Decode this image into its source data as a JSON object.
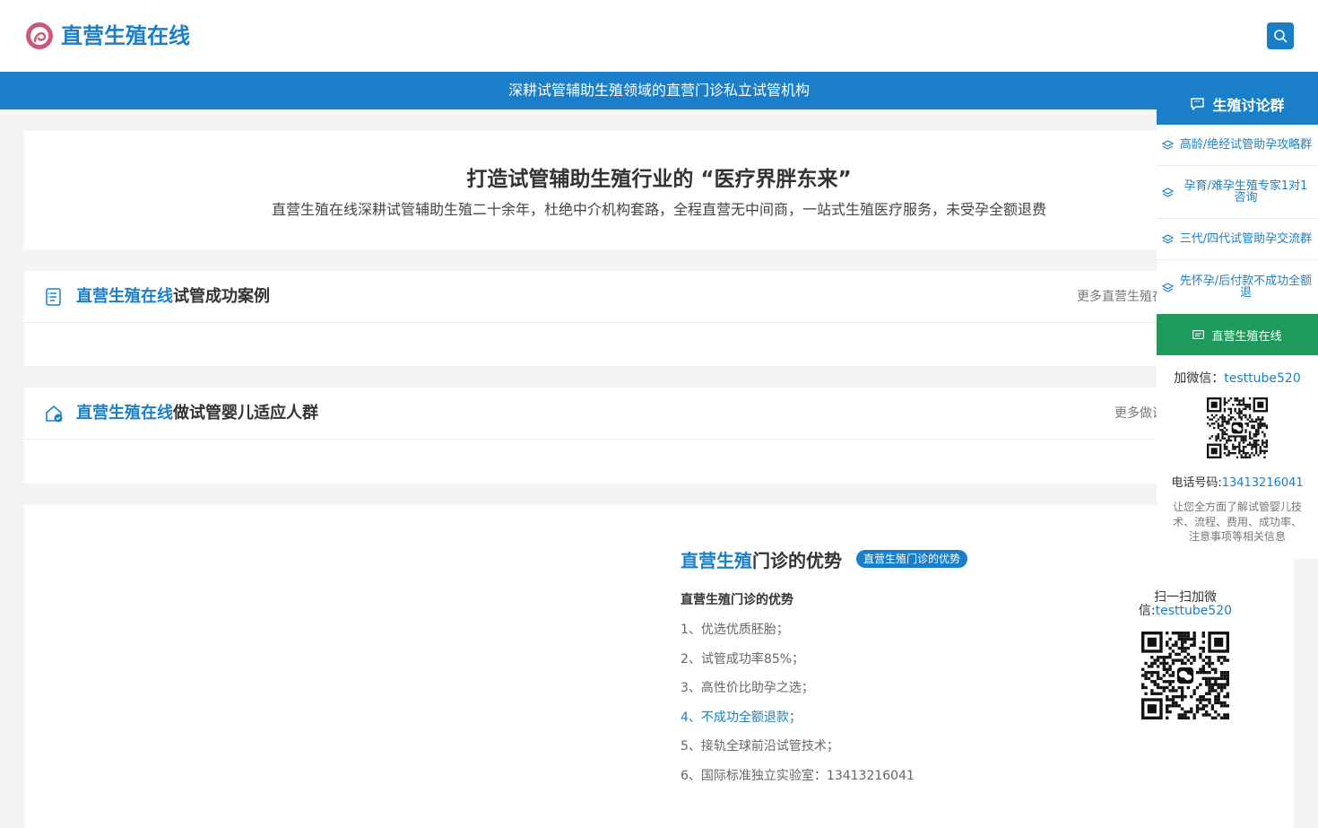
{
  "header": {
    "brand": "直营生殖在线",
    "logo_icon": "logo-icon",
    "search_icon": "search-icon"
  },
  "banner": {
    "text": "深耕试管辅助生殖领域的直营门诊私立试管机构"
  },
  "hero": {
    "title": "打造试管辅助生殖行业的 “医疗界胖东来”",
    "subtitle": "直营生殖在线深耕试管辅助生殖二十余年，杜绝中介机构套路，全程直营无中间商，一站式生殖医疗服务，未受孕全额退费"
  },
  "sections": [
    {
      "title_highlight": "直营生殖在线",
      "title_rest": "试管成功案例",
      "more": "更多直营生殖在",
      "icon": "document-list-icon"
    },
    {
      "title_highlight": "直营生殖在线",
      "title_rest": "做试管婴儿适应人群",
      "more": "更多做试",
      "icon": "home-check-icon"
    }
  ],
  "advantages": {
    "title_highlight": "直营生殖",
    "title_rest": "门诊的优势",
    "tag": "直营生殖门诊的优势",
    "subtitle": "直营生殖门诊的优势",
    "items": [
      "1、优选优质胚胎；",
      "2、试管成功率85%；",
      "3、高性价比助孕之选；",
      "4、不成功全额退款；",
      "5、接轨全球前沿试管技术；",
      "6、国际标准独立实验室：13413216041"
    ],
    "active_index": 3,
    "scan_label": "扫一扫加微信:",
    "scan_wechat": "testtube520"
  },
  "sidebar": {
    "title": "生殖讨论群",
    "items": [
      "高龄/绝经试管助孕攻略群",
      "孕育/难孕生殖专家1对1咨询",
      "三代/四代试管助孕交流群",
      "先怀孕/后付款不成功全额退"
    ],
    "green_button": "直营生殖在线",
    "wechat_label": "加微信：",
    "wechat_id": "testtube520",
    "phone_label": "电话号码:",
    "phone": "13413216041",
    "note": "让您全方面了解试管婴儿技术、流程、费用、成功率、注意事项等相关信息"
  },
  "colors": {
    "accent": "#1a7fc8",
    "green": "#1e9a5b",
    "logo": "#c85a7a"
  }
}
